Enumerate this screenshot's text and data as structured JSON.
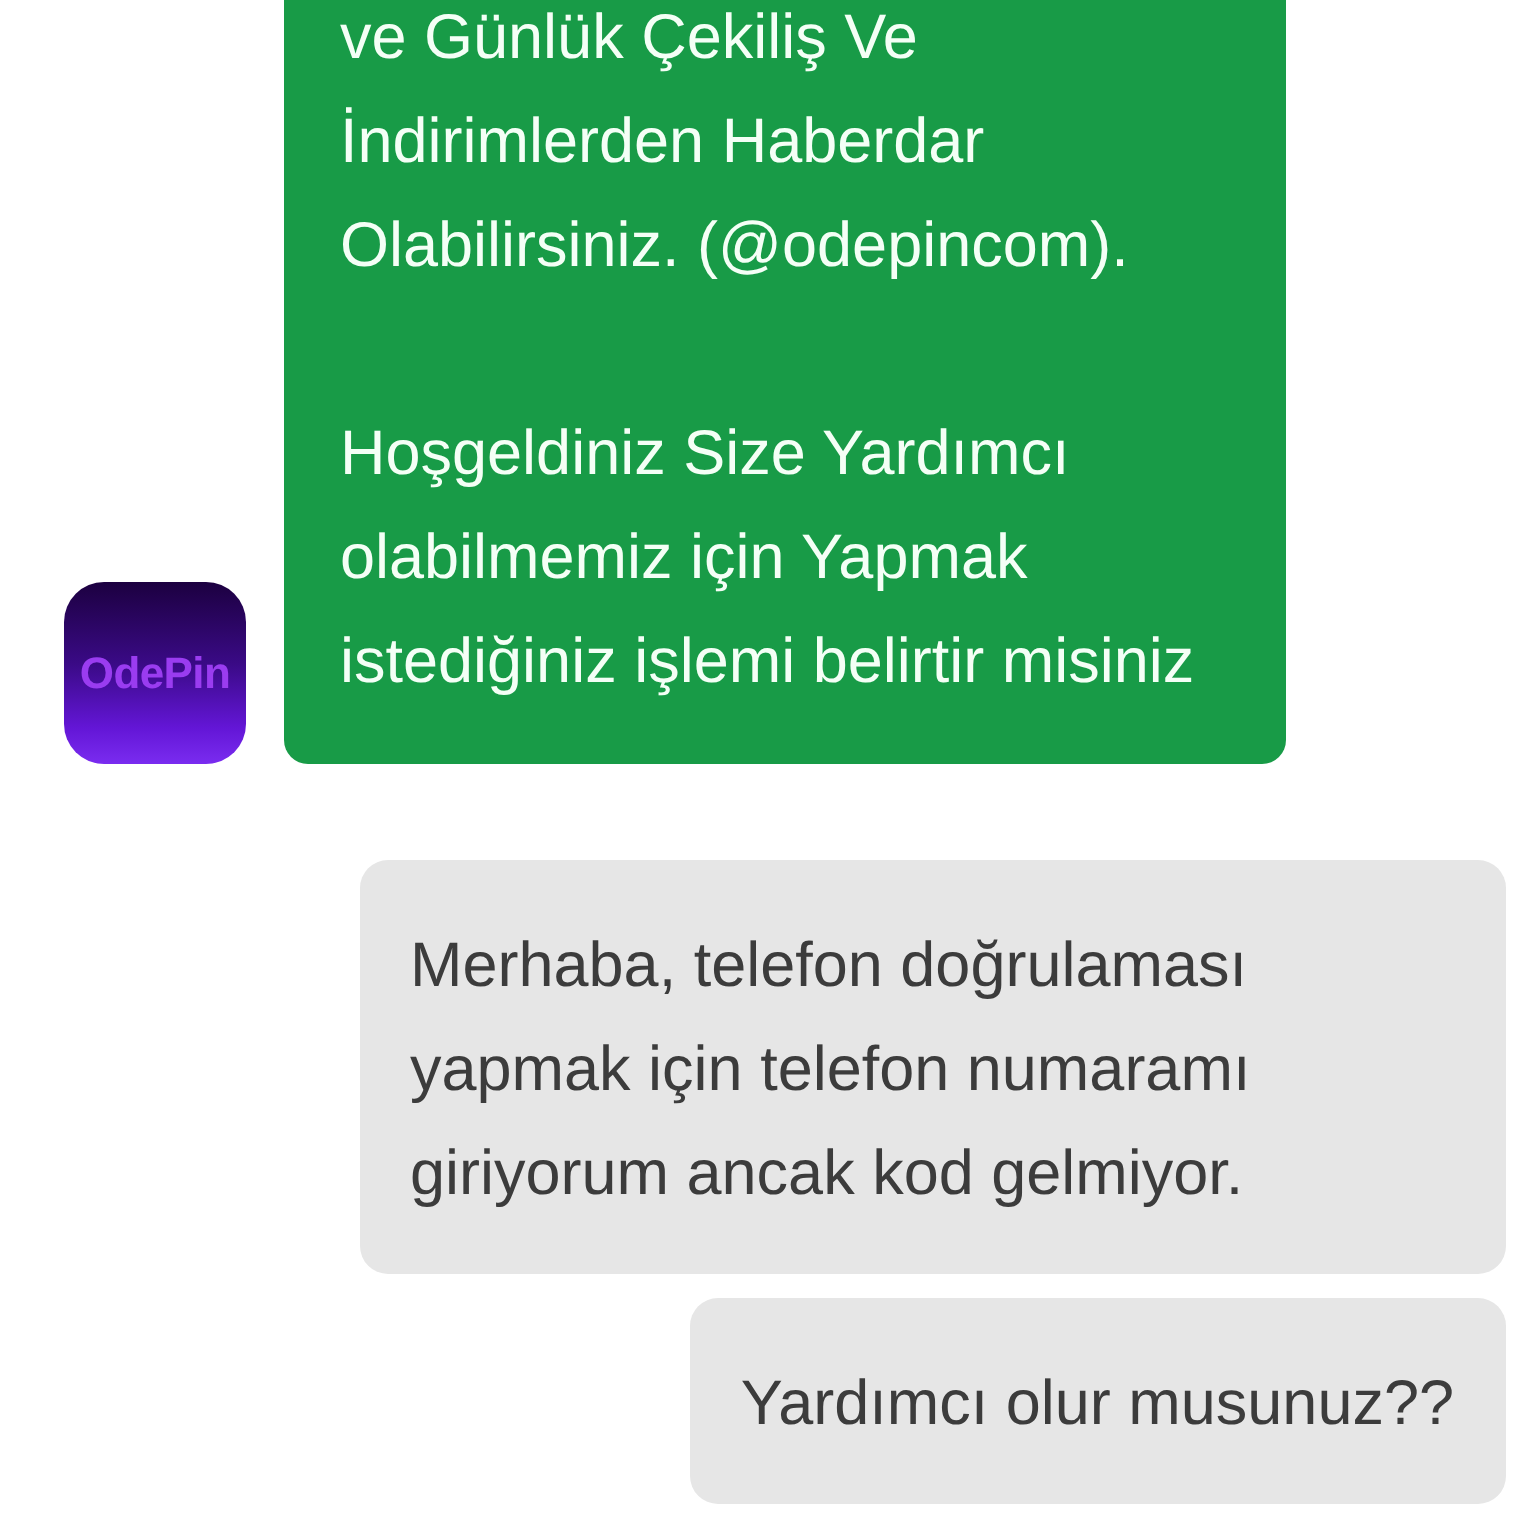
{
  "messages": [
    {
      "kind": "incoming",
      "sender_logo": "OdePin",
      "paragraphs": [
        "ve Günlük Çekiliş Ve İndirimlerden Haberdar Olabilirsiniz. (@odepincom).",
        "Hoşgeldiniz Size Yardımcı olabilmemiz için Yapmak istediğiniz işlemi belirtir misiniz"
      ]
    },
    {
      "kind": "outgoing",
      "paragraphs": [
        "Merhaba, telefon doğrulaması yapmak için telefon numaramı giriyorum ancak kod gelmiyor."
      ]
    },
    {
      "kind": "outgoing",
      "paragraphs": [
        "Yardımcı olur musunuz??"
      ]
    }
  ]
}
